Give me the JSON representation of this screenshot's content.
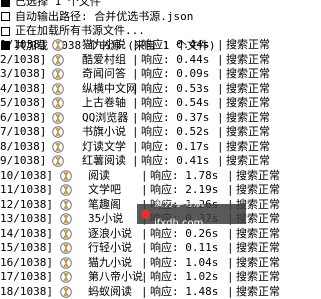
{
  "header": {
    "lines": [
      {
        "text": "已选择 1 个文件",
        "checked": true
      },
      {
        "text": "自动输出路径: 合并优选书源.json",
        "checked": false
      },
      {
        "text": "正在加载所有书源文件...",
        "checked": false
      },
      {
        "text": "共加载 1038 个书源 (来自 1 个文件)",
        "checked": true
      }
    ]
  },
  "rows": [
    {
      "index": "1/1038]",
      "name": "猫九小说",
      "resp": "响应: 0.44s",
      "status": "搜索正常"
    },
    {
      "index": "2/1038]",
      "name": "酷爱村组",
      "resp": "响应: 0.44s",
      "status": "搜索正常"
    },
    {
      "index": "3/1038]",
      "name": "奇闻问答",
      "resp": "响应: 0.09s",
      "status": "搜索正常"
    },
    {
      "index": "4/1038]",
      "name": "纵横中文网",
      "resp": "响应: 0.53s",
      "status": "搜索正常"
    },
    {
      "index": "5/1038]",
      "name": "上古卷轴",
      "resp": "响应: 0.54s",
      "status": "搜索正常"
    },
    {
      "index": "6/1038]",
      "name": "QQ浏览器",
      "resp": "响应: 0.37s",
      "status": "搜索正常"
    },
    {
      "index": "7/1038]",
      "name": "书旗小说",
      "resp": "响应: 0.52s",
      "status": "搜索正常"
    },
    {
      "index": "8/1038]",
      "name": "灯读文学",
      "resp": "响应: 0.17s",
      "status": "搜索正常"
    },
    {
      "index": "9/1038]",
      "name": "红薯阅读",
      "resp": "响应: 0.41s",
      "status": "搜索正常"
    },
    {
      "index": "10/1038]",
      "name": "阅读",
      "resp": "响应: 1.78s",
      "status": "搜索正常"
    },
    {
      "index": "11/1038]",
      "name": "文学吧",
      "resp": "响应: 2.19s",
      "status": "搜索正常"
    },
    {
      "index": "12/1038]",
      "name": "笔趣阁",
      "resp": "响应: 1.26s",
      "status": "搜索正常"
    },
    {
      "index": "13/1038]",
      "name": "35小说",
      "resp": "响应: 0.37s",
      "status": "搜索正常"
    },
    {
      "index": "14/1038]",
      "name": "逐浪小说",
      "resp": "响应: 0.26s",
      "status": "搜索正常"
    },
    {
      "index": "15/1038]",
      "name": "行轻小说",
      "resp": "响应: 0.11s",
      "status": "搜索正常"
    },
    {
      "index": "16/1038]",
      "name": "猫九小说",
      "resp": "响应: 1.04s",
      "status": "搜索正常"
    },
    {
      "index": "17/1038]",
      "name": "第八帝小说",
      "resp": "响应: 1.02s",
      "status": "搜索正常"
    },
    {
      "index": "18/1038]",
      "name": "蚂蚁阅读",
      "resp": "响应: 1.48s",
      "status": "搜索正常"
    }
  ],
  "watermark": {
    "text": "爱分享导航 ifxdh.com"
  },
  "icons": {
    "row_status": "hourglass-icon",
    "watermark": "watermark-logo-icon"
  }
}
